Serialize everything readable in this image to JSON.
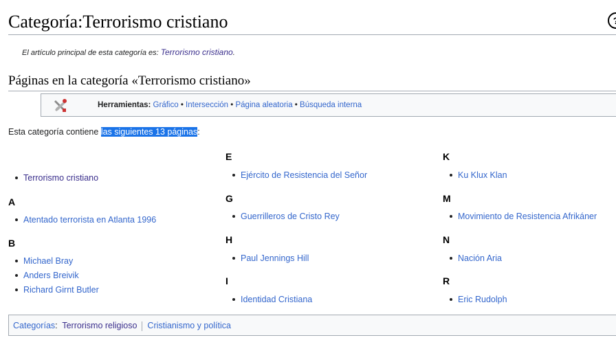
{
  "page": {
    "title": "Categoría:Terrorismo cristiano",
    "help_glyph": "?"
  },
  "hatnote": {
    "prefix": "El artículo principal de esta categoría es: ",
    "link": "Terrorismo cristiano",
    "suffix": "."
  },
  "section": {
    "heading": "Páginas en la categoría «Terrorismo cristiano»"
  },
  "toolbox": {
    "icon": "tools-icon",
    "label": "Herramientas:",
    "links": [
      "Gráfico",
      "Intersección",
      "Página aleatoria",
      "Búsqueda interna"
    ],
    "separator": " • "
  },
  "intro": {
    "prefix": "Esta categoría contiene ",
    "link": "las siguientes 13 páginas",
    "suffix": ":"
  },
  "columns": [
    {
      "groups": [
        {
          "letter": "",
          "items": [
            "Terrorismo cristiano"
          ]
        },
        {
          "letter": "A",
          "items": [
            "Atentado terrorista en Atlanta 1996"
          ]
        },
        {
          "letter": "B",
          "items": [
            "Michael Bray",
            "Anders Breivik",
            "Richard Girnt Butler"
          ]
        }
      ]
    },
    {
      "groups": [
        {
          "letter": "E",
          "items": [
            "Ejército de Resistencia del Señor"
          ]
        },
        {
          "letter": "G",
          "items": [
            "Guerrilleros de Cristo Rey"
          ]
        },
        {
          "letter": "H",
          "items": [
            "Paul Jennings Hill"
          ]
        },
        {
          "letter": "I",
          "items": [
            "Identidad Cristiana"
          ]
        }
      ]
    },
    {
      "groups": [
        {
          "letter": "K",
          "items": [
            "Ku Klux Klan"
          ]
        },
        {
          "letter": "M",
          "items": [
            "Movimiento de Resistencia Afrikáner"
          ]
        },
        {
          "letter": "N",
          "items": [
            "Nación Aria"
          ]
        },
        {
          "letter": "R",
          "items": [
            "Eric Rudolph"
          ]
        }
      ]
    }
  ],
  "categories": {
    "label": "Categorías",
    "links": [
      "Terrorismo religioso",
      "Cristianismo y política"
    ]
  },
  "colors": {
    "link": "#3366cc",
    "visited": "#3a2e8c",
    "selection": "#1a73e8"
  }
}
